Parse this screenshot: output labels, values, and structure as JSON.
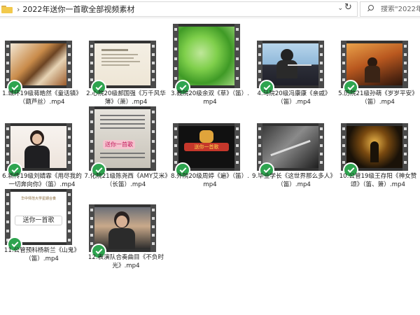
{
  "window": {
    "path_separator": "›",
    "path": "2022年送你一首歌全部视频素材",
    "search_placeholder": "搜索\"2022年送你..."
  },
  "colors": {
    "check": "#2ea44f",
    "folder": "#f2c94c"
  },
  "files": [
    {
      "name": "1.城环19级蒋皓然《童话镇》（葫芦丝）.mp4"
    },
    {
      "name": "2.心院20级郝国强《万千风华薄》（萧）.mp4"
    },
    {
      "name": "3.教院20级余双《草》（笛）.mp4"
    },
    {
      "name": "4.马院20级冯康康《亲戚》（笛）.mp4"
    },
    {
      "name": "5.历院21级孙萌《岁岁平安》（笛）.mp4"
    },
    {
      "name": "6.新传19级刘婧霏《用尽我的一切奔向你》（笛）.mp4"
    },
    {
      "name": "7.化院21级陈尧西《AMY艾米》（长笛）.mp4"
    },
    {
      "name": "8.外院20级周婷《遍》（笛）.mp4"
    },
    {
      "name": "9.毕业学长《这世界那么多人》（笛）.mp4"
    },
    {
      "name": "10.公管19级王存阳《神女赞颂》（笛、箫）.mp4"
    },
    {
      "name": "11.公管预科杨新兰《山鬼》（笛）.mp4"
    },
    {
      "name": "12.表演队合奏曲目《不负时光》.mp4"
    }
  ],
  "thumb_text": {
    "t7_overlay": "送你一首歌",
    "t8_banner": "送你一首歌",
    "t11_header": "华中师范大学星期合奏",
    "t11_title": "送你一首歌"
  }
}
